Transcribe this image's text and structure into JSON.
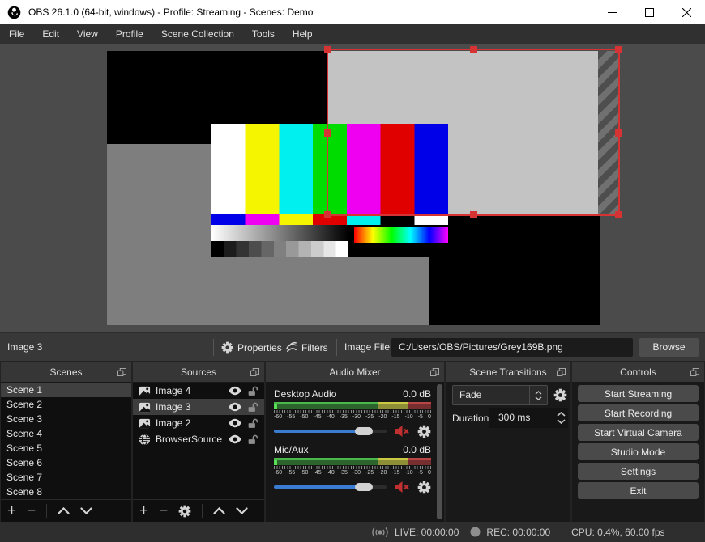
{
  "window": {
    "title": "OBS 26.1.0 (64-bit, windows) - Profile: Streaming - Scenes: Demo"
  },
  "menu": {
    "items": [
      "File",
      "Edit",
      "View",
      "Profile",
      "Scene Collection",
      "Tools",
      "Help"
    ]
  },
  "source_toolbar": {
    "selected_source": "Image 3",
    "properties_label": "Properties",
    "filters_label": "Filters",
    "image_file_label": "Image File",
    "image_file_path": "C:/Users/OBS/Pictures/Grey169B.png",
    "browse_label": "Browse"
  },
  "scenes": {
    "title": "Scenes",
    "items": [
      "Scene 1",
      "Scene 2",
      "Scene 3",
      "Scene 4",
      "Scene 5",
      "Scene 6",
      "Scene 7",
      "Scene 8"
    ],
    "selected": "Scene 1"
  },
  "sources": {
    "title": "Sources",
    "items": [
      {
        "name": "Image 4",
        "icon": "image"
      },
      {
        "name": "Image 3",
        "icon": "image"
      },
      {
        "name": "Image 2",
        "icon": "image"
      },
      {
        "name": "BrowserSource",
        "icon": "globe"
      }
    ],
    "selected": "Image 3"
  },
  "audio_mixer": {
    "title": "Audio Mixer",
    "channels": [
      {
        "name": "Desktop Audio",
        "level": "0.0 dB"
      },
      {
        "name": "Mic/Aux",
        "level": "0.0 dB"
      }
    ],
    "scale_labels": [
      "-60",
      "-55",
      "-50",
      "-45",
      "-40",
      "-35",
      "-30",
      "-25",
      "-20",
      "-15",
      "-10",
      "-5",
      "0"
    ]
  },
  "transitions": {
    "title": "Scene Transitions",
    "transition": "Fade",
    "duration_label": "Duration",
    "duration_value": "300 ms"
  },
  "controls": {
    "title": "Controls",
    "buttons": [
      "Start Streaming",
      "Start Recording",
      "Start Virtual Camera",
      "Studio Mode",
      "Settings",
      "Exit"
    ]
  },
  "status_bar": {
    "live_label": "LIVE: 00:00:00",
    "rec_label": "REC: 00:00:00",
    "cpu_label": "CPU: 0.4%, 60.00 fps"
  },
  "colors": {
    "accent_blue": "#3a7cd0",
    "selection_red": "#d63434",
    "mute_red": "#c03030",
    "meter_green": "#4ab84a",
    "meter_yellow": "#c9c943",
    "meter_red": "#b84646"
  }
}
